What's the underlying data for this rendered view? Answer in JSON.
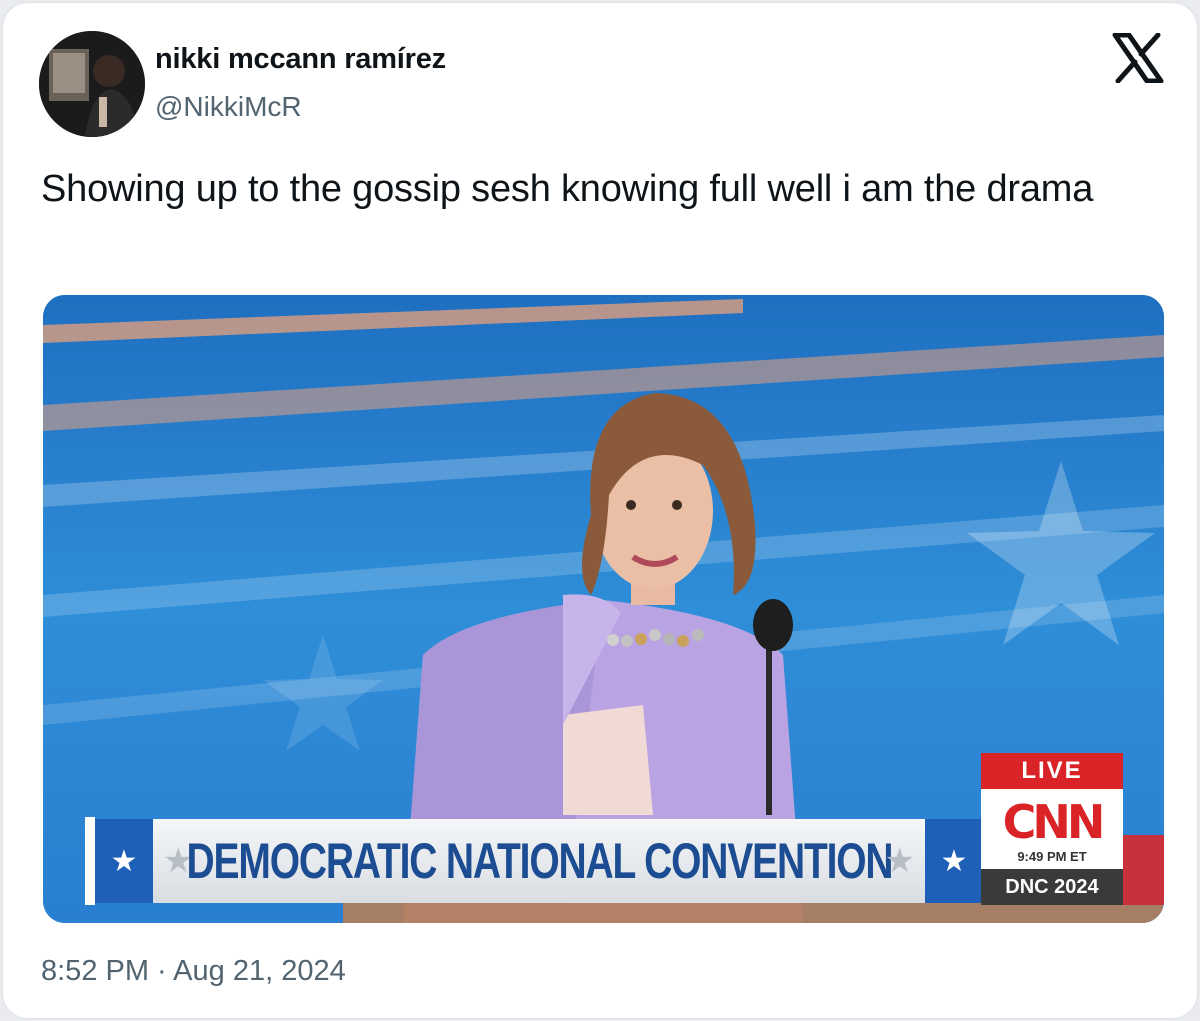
{
  "post": {
    "author_name": "nikki mccann ramírez",
    "author_handle": "@NikkiMcR",
    "text": "Showing up to the gossip sesh knowing full well i am the drama",
    "timestamp": "8:52 PM · Aug 21, 2024",
    "platform_icon": "x-logo-icon"
  },
  "media": {
    "chyron_text": "DEMOCRATIC NATIONAL CONVENTION",
    "star_glyph": "★",
    "live_label": "LIVE",
    "network_logo": "CNN",
    "broadcast_time": "9:49 PM ET",
    "event_tag": "DNC 2024"
  },
  "colors": {
    "background": "#ffffff",
    "text_primary": "#0f1419",
    "text_secondary": "#536471",
    "stage_blue": "#2f8fd6",
    "chyron_blue": "#1c4c92",
    "cnn_red": "#d92327",
    "blazer_lavender": "#b9a3e3"
  }
}
